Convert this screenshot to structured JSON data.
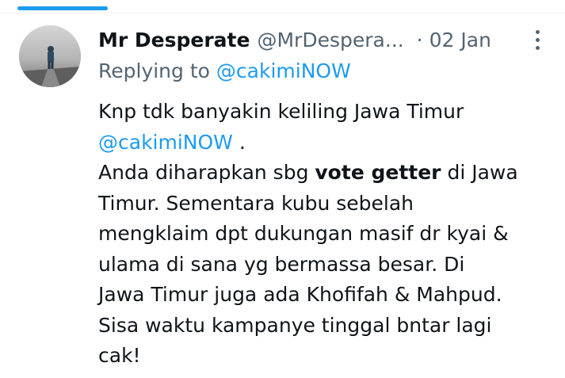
{
  "header": {
    "display_name": "Mr Desperate",
    "handle": "@MrDespera...",
    "separator": "·",
    "date": "02 Jan"
  },
  "reply": {
    "prefix": "Replying to",
    "mention": "@cakimiNOW"
  },
  "body": {
    "line1": "Knp tdk banyakin keliling Jawa Timur",
    "mention": "@cakimiNOW",
    "after_mention": " .",
    "line3_pre": "Anda diharapkan sbg ",
    "line3_bold": "vote getter",
    "line3_post": " di Jawa",
    "line4": "Timur. Sementara kubu sebelah",
    "line5": "mengklaim dpt dukungan masif dr kyai &",
    "line6": "ulama di sana yg bermassa besar. Di",
    "line7": "Jawa Timur juga ada Khofifah & Mahpud.",
    "line8": "Sisa waktu kampanye tinggal bntar lagi",
    "line9": "cak!"
  },
  "colors": {
    "accent": "#1d9bf0",
    "secondary_text": "#536471",
    "primary_text": "#0f1419"
  },
  "icons": {
    "more": "more-vertical-icon"
  }
}
